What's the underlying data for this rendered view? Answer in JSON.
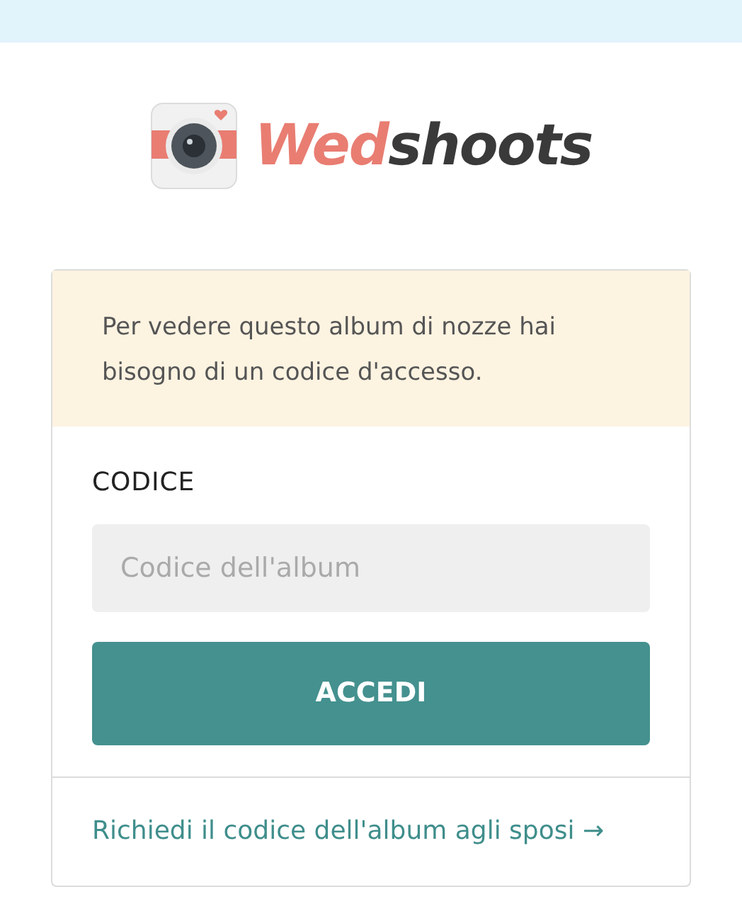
{
  "logo": {
    "parts": [
      "Wed",
      "shoots"
    ]
  },
  "notice": "Per vedere questo album di nozze hai bisogno di un codice d'accesso.",
  "field": {
    "label": "CODICE",
    "placeholder": "Codice dell'album"
  },
  "submit_button": "ACCEDI",
  "request_link": "Richiedi il codice dell'album agli sposi →"
}
